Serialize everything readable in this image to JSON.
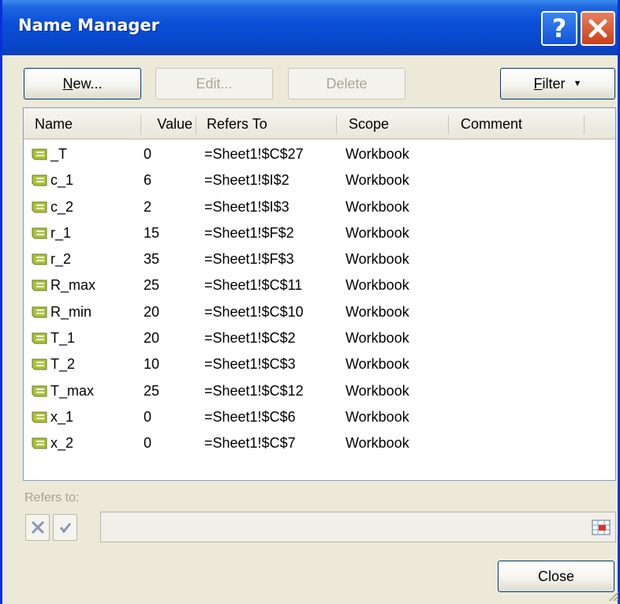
{
  "window": {
    "title": "Name Manager"
  },
  "toolbar": {
    "new_label_u": "N",
    "new_label_rest": "ew...",
    "edit_label": "Edit...",
    "delete_label": "Delete",
    "filter_label_u": "F",
    "filter_label_rest": "ilter",
    "filter_arrow": "▼"
  },
  "table": {
    "columns": [
      "Name",
      "Value",
      "Refers To",
      "Scope",
      "Comment"
    ],
    "rows": [
      {
        "name": "_T",
        "value": "0",
        "refers_to": "=Sheet1!$C$27",
        "scope": "Workbook",
        "comment": ""
      },
      {
        "name": "c_1",
        "value": "6",
        "refers_to": "=Sheet1!$I$2",
        "scope": "Workbook",
        "comment": ""
      },
      {
        "name": "c_2",
        "value": "2",
        "refers_to": "=Sheet1!$I$3",
        "scope": "Workbook",
        "comment": ""
      },
      {
        "name": "r_1",
        "value": "15",
        "refers_to": "=Sheet1!$F$2",
        "scope": "Workbook",
        "comment": ""
      },
      {
        "name": "r_2",
        "value": "35",
        "refers_to": "=Sheet1!$F$3",
        "scope": "Workbook",
        "comment": ""
      },
      {
        "name": "R_max",
        "value": "25",
        "refers_to": "=Sheet1!$C$11",
        "scope": "Workbook",
        "comment": ""
      },
      {
        "name": "R_min",
        "value": "20",
        "refers_to": "=Sheet1!$C$10",
        "scope": "Workbook",
        "comment": ""
      },
      {
        "name": "T_1",
        "value": "20",
        "refers_to": "=Sheet1!$C$2",
        "scope": "Workbook",
        "comment": ""
      },
      {
        "name": "T_2",
        "value": "10",
        "refers_to": "=Sheet1!$C$3",
        "scope": "Workbook",
        "comment": ""
      },
      {
        "name": "T_max",
        "value": "25",
        "refers_to": "=Sheet1!$C$12",
        "scope": "Workbook",
        "comment": ""
      },
      {
        "name": "x_1",
        "value": "0",
        "refers_to": "=Sheet1!$C$6",
        "scope": "Workbook",
        "comment": ""
      },
      {
        "name": "x_2",
        "value": "0",
        "refers_to": "=Sheet1!$C$7",
        "scope": "Workbook",
        "comment": ""
      }
    ]
  },
  "refers_to": {
    "label": "Refers to:",
    "value": ""
  },
  "footer": {
    "close_label": "Close"
  },
  "icons": {
    "help": "help-icon",
    "close": "close-icon",
    "name_row": "defined-name-icon",
    "cancel": "cancel-x-icon",
    "confirm": "checkmark-icon",
    "range_select": "collapse-dialog-icon"
  },
  "colors": {
    "titlebar": "#0848cc",
    "dialog_bg": "#ece9d8",
    "close_button": "#c9401a",
    "name_icon": "#a9c23a"
  }
}
